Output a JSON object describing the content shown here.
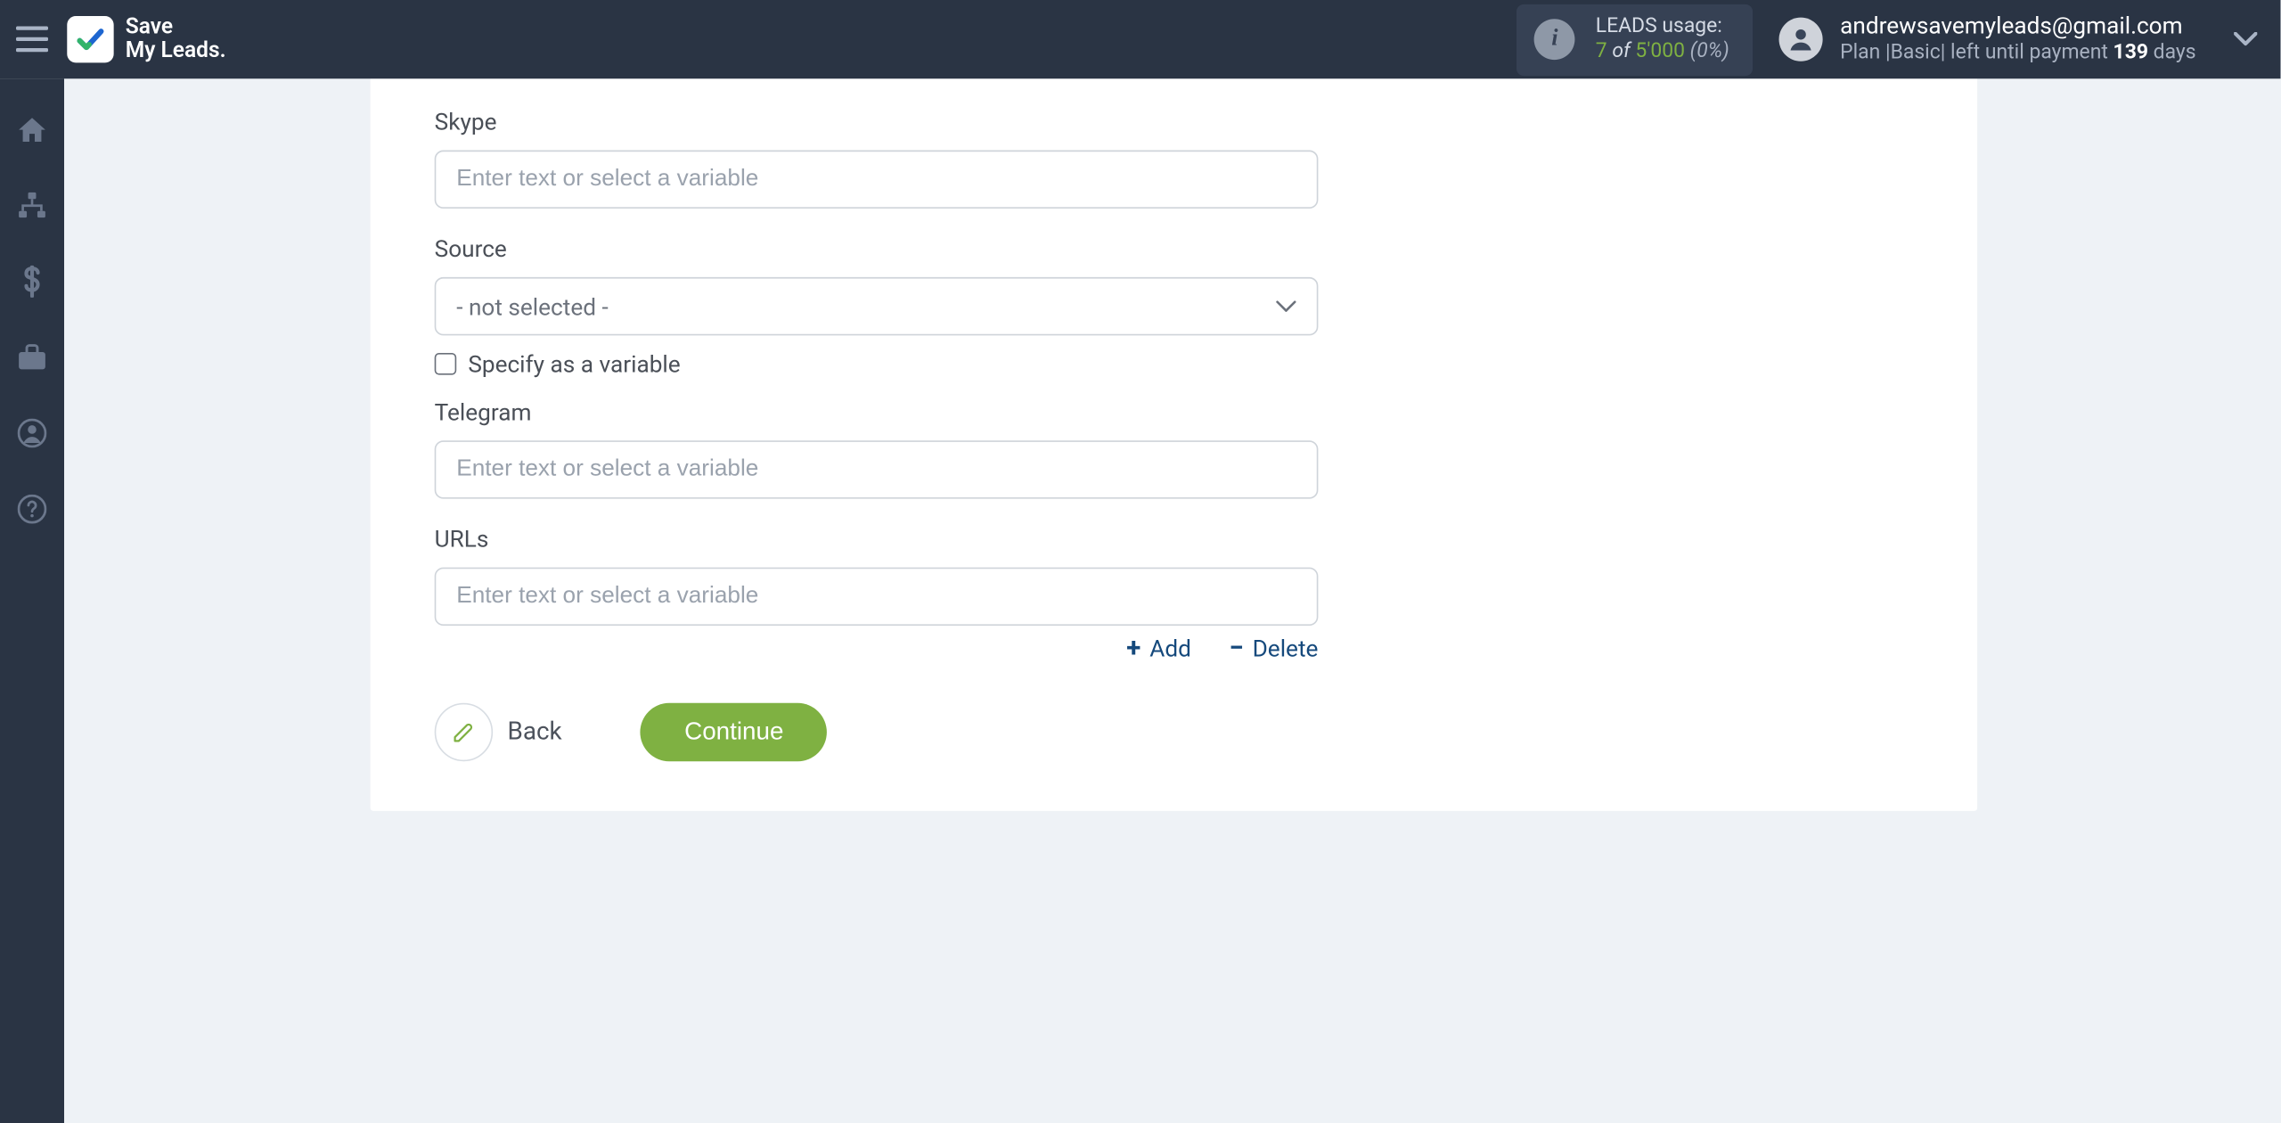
{
  "brand": {
    "name_line1": "Save",
    "name_line2": "My Leads."
  },
  "leads_usage": {
    "title": "LEADS usage:",
    "used": "7",
    "of_word": "of",
    "quota": "5'000",
    "percent": "(0%)"
  },
  "account": {
    "email": "andrewsavemyleads@gmail.com",
    "plan_prefix": "Plan |",
    "plan_name": "Basic",
    "plan_mid": "| left until payment ",
    "days": "139",
    "plan_suffix": " days"
  },
  "sidebar": {
    "items": [
      {
        "name": "home"
      },
      {
        "name": "connections"
      },
      {
        "name": "billing"
      },
      {
        "name": "briefcase"
      },
      {
        "name": "profile"
      },
      {
        "name": "help"
      }
    ]
  },
  "form": {
    "skype": {
      "label": "Skype",
      "placeholder": "Enter text or select a variable",
      "value": ""
    },
    "source": {
      "label": "Source",
      "selected": "- not selected -",
      "checkbox_label": "Specify as a variable"
    },
    "telegram": {
      "label": "Telegram",
      "placeholder": "Enter text or select a variable",
      "value": ""
    },
    "urls": {
      "label": "URLs",
      "placeholder": "Enter text or select a variable",
      "value": ""
    },
    "actions": {
      "add": "Add",
      "delete": "Delete"
    },
    "buttons": {
      "back": "Back",
      "continue": "Continue"
    }
  }
}
